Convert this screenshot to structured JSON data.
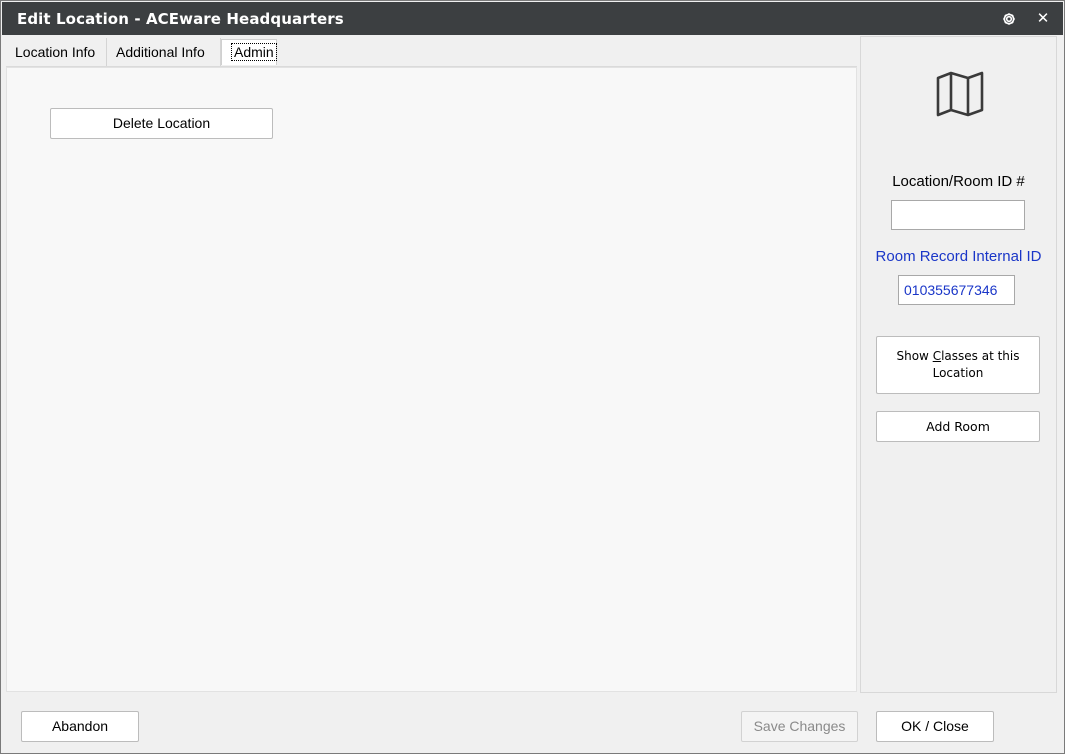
{
  "window": {
    "title": "Edit Location - ACEware Headquarters",
    "icons": {
      "settings": "gear-icon",
      "close": "close-icon"
    },
    "close_glyph": "✕"
  },
  "tabs": [
    {
      "label": "Location Info",
      "active": false
    },
    {
      "label": "Additional Info",
      "active": false
    },
    {
      "label": "Admin",
      "active": true
    }
  ],
  "admin_tab": {
    "delete_button_label": "Delete Location"
  },
  "side_panel": {
    "icon": "map-icon",
    "room_id_label": "Location/Room ID #",
    "room_id_value": "",
    "internal_id_label": "Room Record Internal ID",
    "internal_id_value": "010355677346",
    "show_classes_line1": "Show Classes at this",
    "show_classes_line2": "Location",
    "show_classes_access_key": "C",
    "add_room_label": "Add Room"
  },
  "footer": {
    "abandon_label": "Abandon",
    "save_label": "Save Changes",
    "save_enabled": false,
    "ok_close_label": "OK / Close"
  },
  "colors": {
    "titlebar": "#3c3f41",
    "link_blue": "#1a36c8",
    "disabled_text": "#8a8a8a"
  }
}
